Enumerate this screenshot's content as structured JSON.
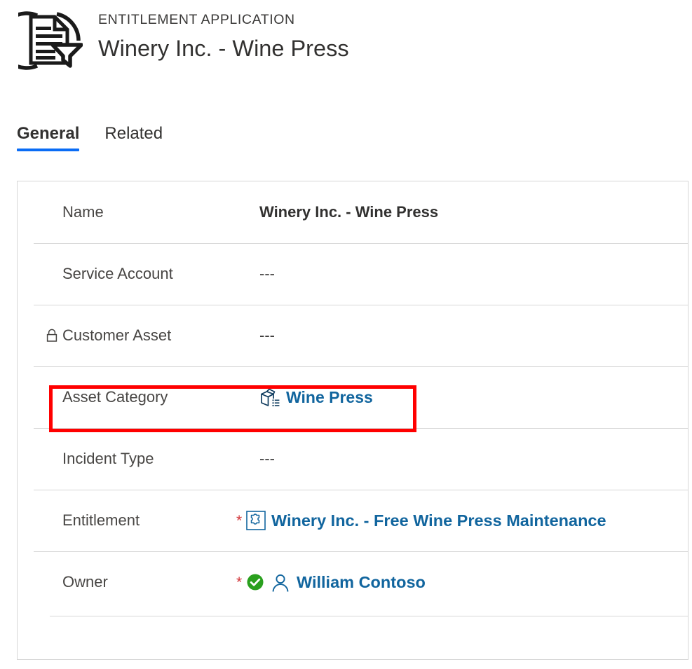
{
  "header": {
    "icon": "entitlement-application-document-filter-icon",
    "eyebrow": "ENTITLEMENT APPLICATION",
    "title": "Winery Inc. - Wine Press"
  },
  "tabs": [
    {
      "label": "General",
      "active": true
    },
    {
      "label": "Related",
      "active": false
    }
  ],
  "form": {
    "rows": [
      {
        "label": "Name",
        "value": "Winery Inc. - Wine Press",
        "style": "bold",
        "required": false,
        "lock": false,
        "icon": null
      },
      {
        "label": "Service Account",
        "value": "---",
        "style": "empty",
        "required": false,
        "lock": false,
        "icon": null
      },
      {
        "label": "Customer Asset",
        "value": "---",
        "style": "empty",
        "required": false,
        "lock": true,
        "lock_icon": "lock-icon",
        "icon": null
      },
      {
        "label": "Asset Category",
        "value": "Wine Press",
        "style": "link",
        "required": false,
        "lock": false,
        "icon": "product-box-list-icon",
        "highlighted": true
      },
      {
        "label": "Incident Type",
        "value": "---",
        "style": "empty",
        "required": false,
        "lock": false,
        "icon": null
      },
      {
        "label": "Entitlement",
        "value": "Winery Inc. - Free Wine Press Maintenance",
        "style": "link",
        "required": true,
        "required_marker": "*",
        "lock": false,
        "icon": "entitlement-puzzle-icon"
      },
      {
        "label": "Owner",
        "value": "William Contoso",
        "style": "link",
        "required": true,
        "required_marker": "*",
        "lock": false,
        "icon": "user-person-icon",
        "status_icon": "green-check-circle-icon"
      }
    ]
  },
  "colors": {
    "link": "#11659e",
    "tab_accent": "#0a6cf5",
    "required": "#d13438",
    "status_ok": "#2aa01e",
    "highlight_box": "#ff0000",
    "divider": "#d6d6d6",
    "label_text": "#484644"
  }
}
